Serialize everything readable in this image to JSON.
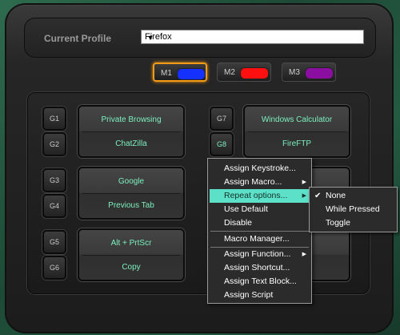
{
  "header": {
    "label": "Current Profile",
    "profile_value": "Firefox",
    "dropdown_arrow": "▼"
  },
  "mode_tabs": [
    {
      "label": "M1",
      "color": "#1431ff"
    },
    {
      "label": "M2",
      "color": "#ff1010"
    },
    {
      "label": "M3",
      "color": "#8a0ea0"
    }
  ],
  "gkeys": [
    "G1",
    "G2",
    "G3",
    "G4",
    "G5",
    "G6",
    "G7",
    "G8"
  ],
  "macros": [
    {
      "top": "Private Browsing",
      "bottom": "ChatZilla"
    },
    {
      "top": "Google",
      "bottom": "Previous Tab"
    },
    {
      "top": "Alt + PrtScr",
      "bottom": "Copy"
    },
    {
      "top": "Windows Calculator",
      "bottom": "FireFTP"
    }
  ],
  "context_menu": {
    "items": [
      "Assign Keystroke...",
      "Assign Macro...",
      "Repeat options...",
      "Use Default",
      "Disable",
      "Macro Manager...",
      "Assign Function...",
      "Assign Shortcut...",
      "Assign Text Block...",
      "Assign Script"
    ],
    "arrow": "▶"
  },
  "submenu": {
    "items": [
      "None",
      "While Pressed",
      "Toggle"
    ],
    "check": "✔"
  }
}
